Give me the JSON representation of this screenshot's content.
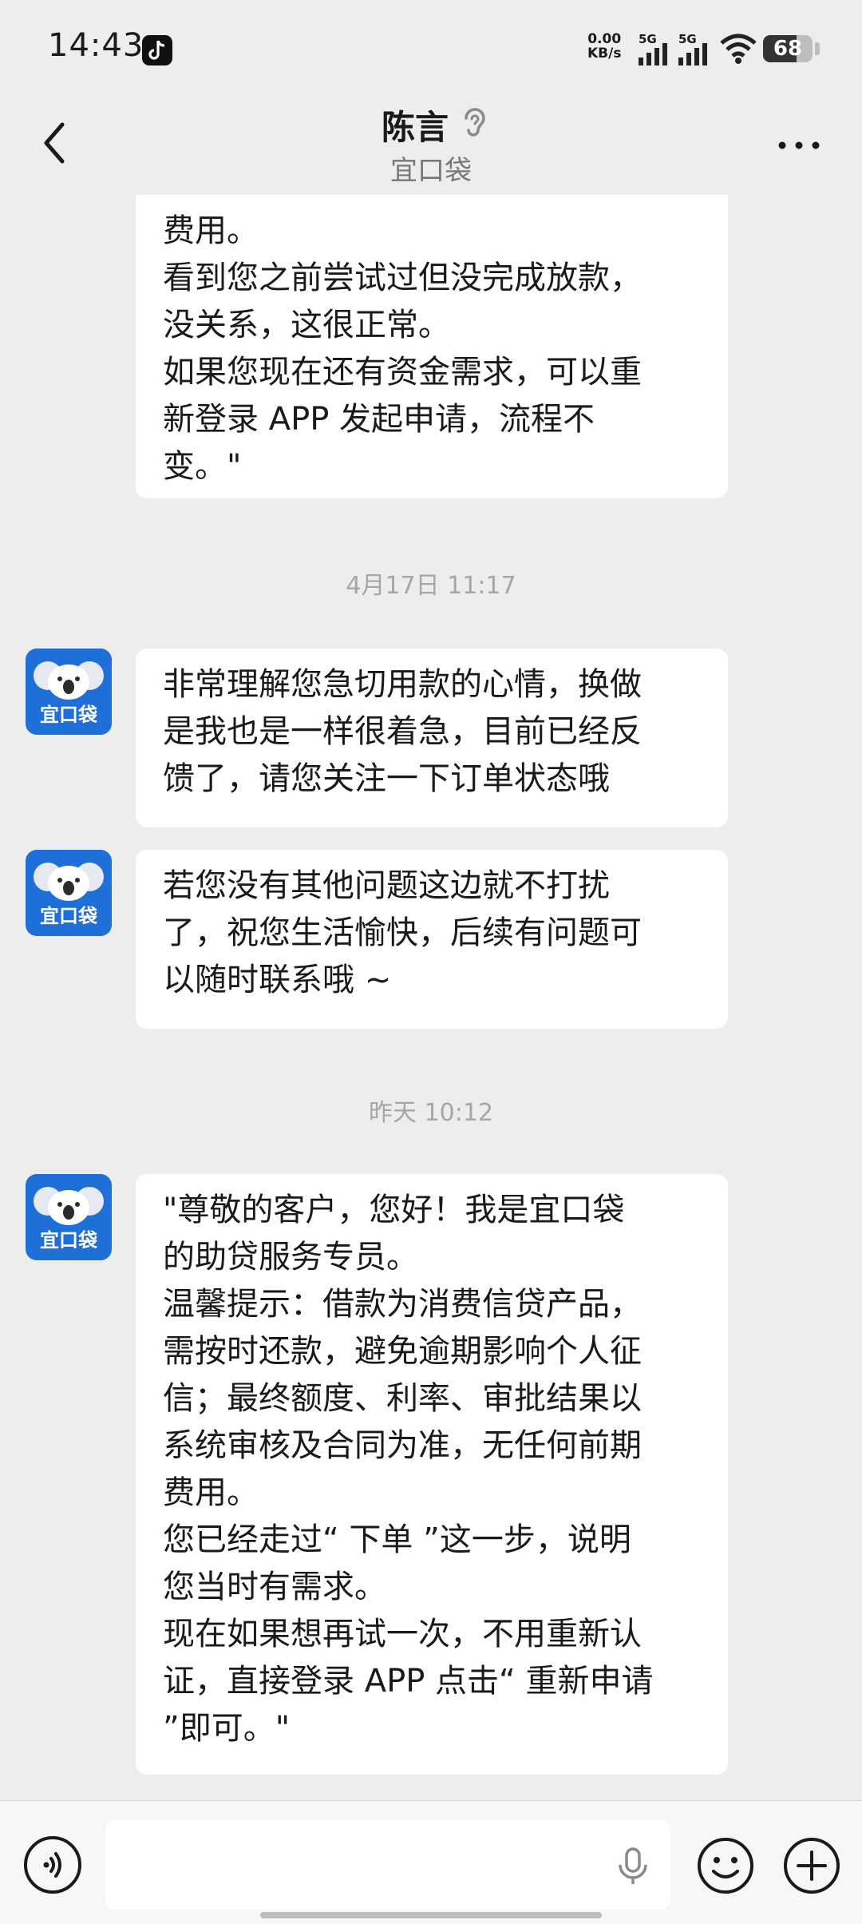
{
  "status_bar": {
    "time": "14:43",
    "net_speed_value": "0.00",
    "net_speed_unit": "KB/s",
    "signal_1_label": "5G",
    "signal_2_label": "5G",
    "battery_level": "68",
    "battery_fraction": 0.68
  },
  "header": {
    "contact_name": "陈言",
    "contact_org": "宜口袋"
  },
  "chat": {
    "messages": [
      {
        "text": "费用。\n看到您之前尝试过但没完成放款，\n没关系，这很正常。\n如果您现在还有资金需求，可以重\n新登录 APP 发起申请，流程不\n变。\""
      },
      {
        "text": "非常理解您急切用款的心情，换做\n是我也是一样很着急，目前已经反\n馈了，请您关注一下订单状态哦"
      },
      {
        "text": "若您没有其他问题这边就不打扰\n了，祝您生活愉快，后续有问题可\n以随时联系哦 ~"
      },
      {
        "text": "\"尊敬的客户，您好！我是宜口袋\n的助贷服务专员。\n温馨提示：借款为消费信贷产品，\n需按时还款，避免逾期影响个人征\n信；最终额度、利率、审批结果以\n系统审核及合同为准，无任何前期\n费用。\n您已经走过“ 下单 ”这一步，说明\n您当时有需求。\n现在如果想再试一次，不用重新认\n证，直接登录 APP 点击“ 重新申请\n”即可。\""
      }
    ],
    "timestamps": [
      "4月17日 11:17",
      "昨天 10:12"
    ],
    "avatar_brand": "宜口袋"
  },
  "input_bar": {
    "value": "",
    "icons": [
      "voice-icon",
      "microphone-icon",
      "emoji-icon",
      "plus-icon"
    ]
  }
}
